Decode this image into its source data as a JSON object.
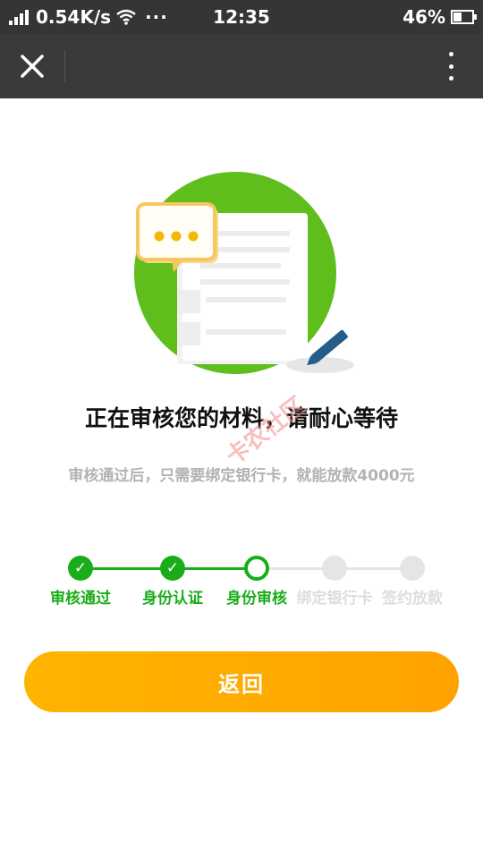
{
  "status_bar": {
    "network_speed": "0.54K/s",
    "more_glyph": "···",
    "time": "12:35",
    "battery": "46%",
    "battery_level": 0.46
  },
  "nav_bar": {
    "close_icon": "close-icon",
    "more_icon": "more-vertical-icon"
  },
  "main": {
    "headline": "正在审核您的材料，请耐心等待",
    "subtext": "审核通过后，只需要绑定银行卡，就能放款4000元",
    "watermark": "卡农社区"
  },
  "steps": [
    {
      "label": "审核通过",
      "state": "done"
    },
    {
      "label": "身份认证",
      "state": "done"
    },
    {
      "label": "身份审核",
      "state": "current"
    },
    {
      "label": "绑定银行卡",
      "state": "pending"
    },
    {
      "label": "签约放款",
      "state": "pending"
    }
  ],
  "actions": {
    "return_label": "返回"
  },
  "colors": {
    "accent_green": "#1aac19",
    "button_orange": "#ffa200",
    "nav_bg": "#3a3a3a"
  }
}
